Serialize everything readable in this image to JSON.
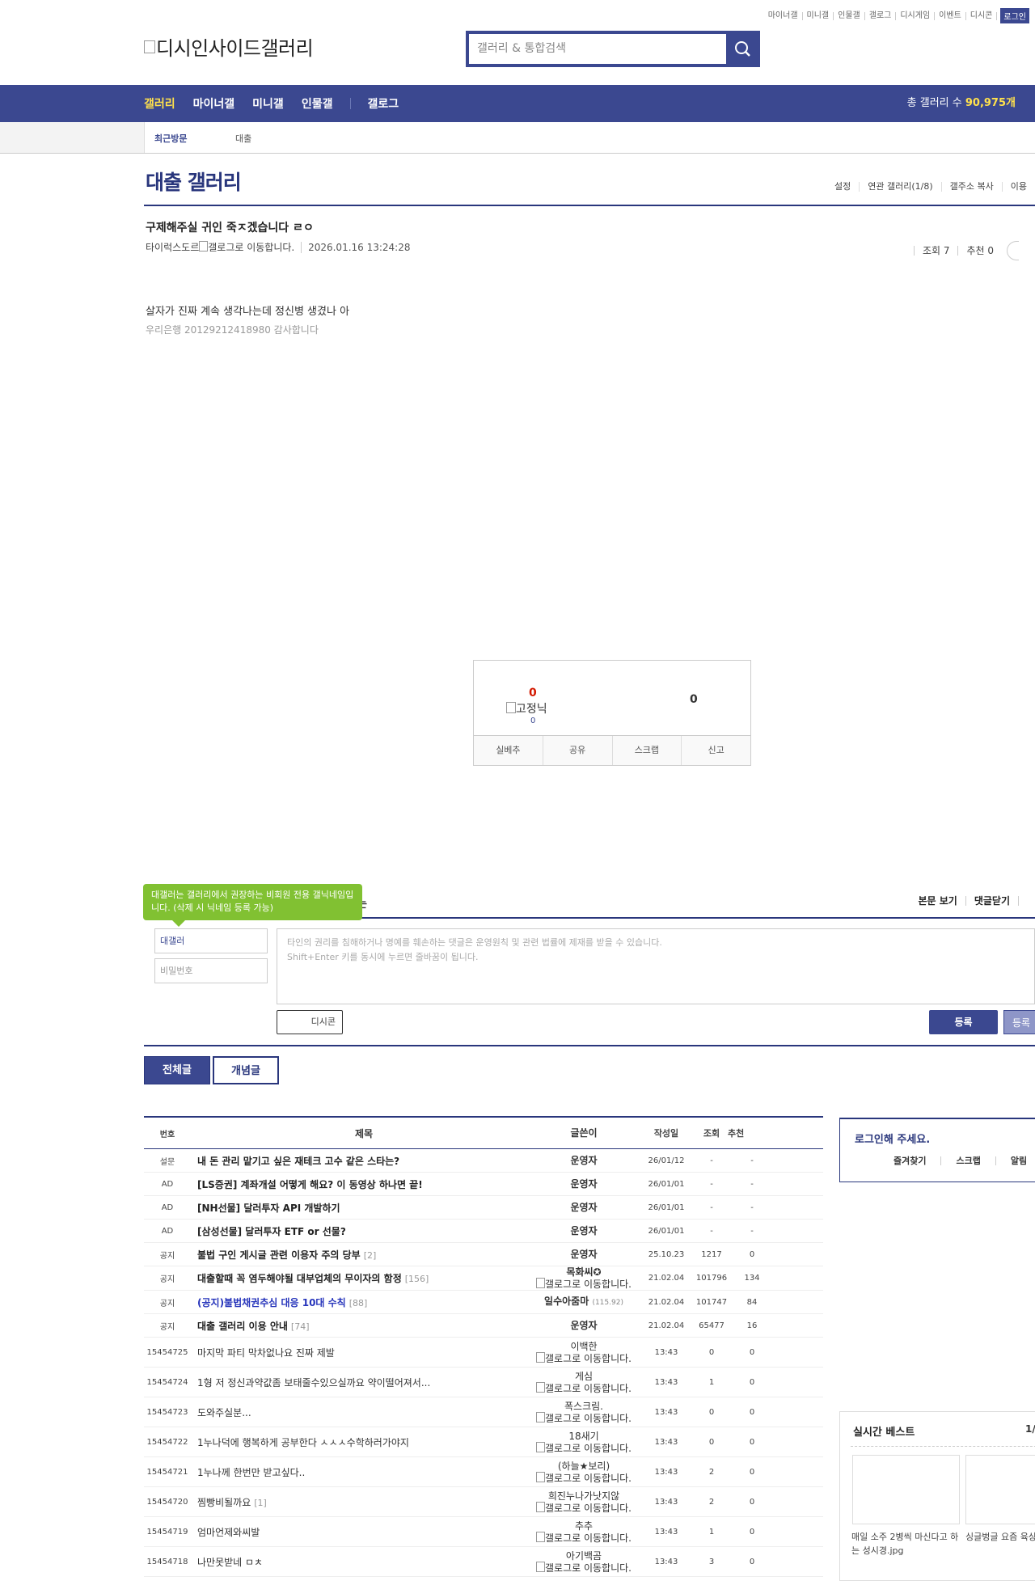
{
  "util": [
    "마이너갤",
    "미니갤",
    "인물갤",
    "갤로그",
    "디시게임",
    "이벤트",
    "디시콘"
  ],
  "util_login": "로그인",
  "logo_text": "디시인사이드갤러리",
  "search_placeholder": "갤러리 & 통합검색",
  "gnb": {
    "items": [
      "갤러리",
      "마이너갤",
      "미니갤",
      "인물갤",
      "갤로그"
    ],
    "total_label": "총 갤러리 수 ",
    "total_count": "90,975개",
    "active_color": "#ffe14c",
    "brand_color": "#3b4890"
  },
  "recent": {
    "label": "최근방문",
    "item": "대출"
  },
  "gallery_title": "대출 갤러리",
  "gallery_opts": [
    "설정",
    "연관 갤러리(1/8)",
    "갤주소 복사",
    "이용"
  ],
  "post": {
    "title": "구제해주실 귀인 죽ㅈ겠습니다 ㄹㅇ",
    "author": "타이럭스도르",
    "author_img_alt": "갤로그로 이동합니다.",
    "date": "2026.01.16 13:24:28",
    "views": "조회 7",
    "recommend": "추천 0",
    "body": "살자가 진짜 계속 생각나는데 정신병 생겼나 아",
    "body2": "우리은행 20129212418980 감사합니다"
  },
  "recommend_box": {
    "up": "0",
    "fix_label": "고정닉",
    "fix_count": "0",
    "down": "0",
    "buttons": [
      "실베추",
      "공유",
      "스크랩",
      "신고"
    ]
  },
  "comment": {
    "tip": "대갤러는 갤러리에서 권장하는 비회원 전용 갤닉네임입니다. (삭제 시 닉네임 등록 가능)",
    "head_partial": "는",
    "view_body": "본문 보기",
    "close": "댓글닫기",
    "nick": "대갤러",
    "password": "비밀번호",
    "textarea_line1": "타인의 권리를 침해하거나 명예를 훼손하는 댓글은 운영원칙 및 관련 법률에 제재를 받을 수 있습니다.",
    "textarea_line2": "Shift+Enter 키를 동시에 누르면 줄바꿈이 됩니다.",
    "dccon": "디시콘",
    "submit": "등록",
    "submit2": "등록"
  },
  "tabs": [
    "전체글",
    "개념글"
  ],
  "list": {
    "headers": [
      "번호",
      "제목",
      "글쓴이",
      "작성일",
      "조회",
      "추천"
    ],
    "rows": [
      {
        "num": "설문",
        "title": "내 돈 관리 맡기고 싶은 재테크 고수 같은 스타는?",
        "reply": "",
        "writer": "운영자",
        "writer_sub": "",
        "date": "26/01/12",
        "views": "-",
        "rec": "-",
        "notice": true
      },
      {
        "num": "AD",
        "title": "[LS증권] 계좌개설 어떻게 해요? 이 동영상 하나면 끝!",
        "reply": "",
        "writer": "운영자",
        "writer_sub": "",
        "date": "26/01/01",
        "views": "-",
        "rec": "-",
        "notice": true
      },
      {
        "num": "AD",
        "title": "[NH선물] 달러투자 API 개발하기",
        "reply": "",
        "writer": "운영자",
        "writer_sub": "",
        "date": "26/01/01",
        "views": "-",
        "rec": "-",
        "notice": true
      },
      {
        "num": "AD",
        "title": "[삼성선물] 달러투자 ETF or 선물?",
        "reply": "",
        "writer": "운영자",
        "writer_sub": "",
        "date": "26/01/01",
        "views": "-",
        "rec": "-",
        "notice": true
      },
      {
        "num": "공지",
        "title": "불법 구인 게시글 관련 이용자 주의 당부",
        "reply": "[2]",
        "writer": "운영자",
        "writer_sub": "",
        "date": "25.10.23",
        "views": "1217",
        "rec": "0",
        "notice": true
      },
      {
        "num": "공지",
        "title": "대출할때 꼭 염두해야될 대부업체의 무이자의 함정",
        "reply": "[156]",
        "writer": "목화씨✪",
        "writer_sub": "갤로그로 이동합니다.",
        "date": "21.02.04",
        "views": "101796",
        "rec": "134",
        "notice": true
      },
      {
        "num": "공지",
        "title": "(공지)불법채권추심 대응 10대 수칙",
        "reply": "[88]",
        "writer": "일수아줌마",
        "writer_ip": "(115.92)",
        "writer_sub": "",
        "date": "21.02.04",
        "views": "101747",
        "rec": "84",
        "notice": true,
        "blue": true
      },
      {
        "num": "공지",
        "title": "대출 갤러리 이용 안내",
        "reply": "[74]",
        "writer": "운영자",
        "writer_sub": "",
        "date": "21.02.04",
        "views": "65477",
        "rec": "16",
        "notice": true
      },
      {
        "num": "15454725",
        "title": "마지막 파티 막차없나요 진짜 제발",
        "reply": "",
        "writer": "이백한",
        "writer_sub": "갤로그로 이동합니다.",
        "date": "13:43",
        "views": "0",
        "rec": "0"
      },
      {
        "num": "15454724",
        "title": "1형 저 정신과약값좀 보태줄수있으실까요 약이떨어져서...",
        "reply": "",
        "writer": "게심",
        "writer_sub": "갤로그로 이동합니다.",
        "date": "13:43",
        "views": "1",
        "rec": "0"
      },
      {
        "num": "15454723",
        "title": "도와주실분...",
        "reply": "",
        "writer": "폭스크림.",
        "writer_sub": "갤로그로 이동합니다.",
        "date": "13:43",
        "views": "0",
        "rec": "0"
      },
      {
        "num": "15454722",
        "title": "1누나덕에 행복하게 공부한다 ㅅㅅㅅ수학하러가야지",
        "reply": "",
        "writer": "18새기",
        "writer_sub": "갤로그로 이동합니다.",
        "date": "13:43",
        "views": "0",
        "rec": "0"
      },
      {
        "num": "15454721",
        "title": "1누나께 한번만 받고싶다..",
        "reply": "",
        "writer": "(하늘★보리)",
        "writer_sub": "갤로그로 이동합니다.",
        "date": "13:43",
        "views": "2",
        "rec": "0"
      },
      {
        "num": "15454720",
        "title": "찜빵비될까요",
        "reply": "[1]",
        "writer": "희진누나가낫지않",
        "writer_sub": "갤로그로 이동합니다.",
        "date": "13:43",
        "views": "2",
        "rec": "0"
      },
      {
        "num": "15454719",
        "title": "엄마언제와씨발",
        "reply": "",
        "writer": "추추",
        "writer_sub": "갤로그로 이동합니다.",
        "date": "13:43",
        "views": "1",
        "rec": "0"
      },
      {
        "num": "15454718",
        "title": "나만못받네 ㅁㅊ",
        "reply": "",
        "writer": "아기백곰",
        "writer_sub": "갤로그로 이동합니다.",
        "date": "13:43",
        "views": "3",
        "rec": "0"
      }
    ]
  },
  "sidebar": {
    "login_title": "로그인해 주세요.",
    "login_links": [
      "즐겨찾기",
      "스크랩",
      "알림"
    ],
    "best_title": "실시간 베스트",
    "best_page": "1/",
    "best_items": [
      "매일 소주 2병씩 마신다고 하는 성시경.jpg",
      "싱글벙글 요즘 육상"
    ]
  }
}
